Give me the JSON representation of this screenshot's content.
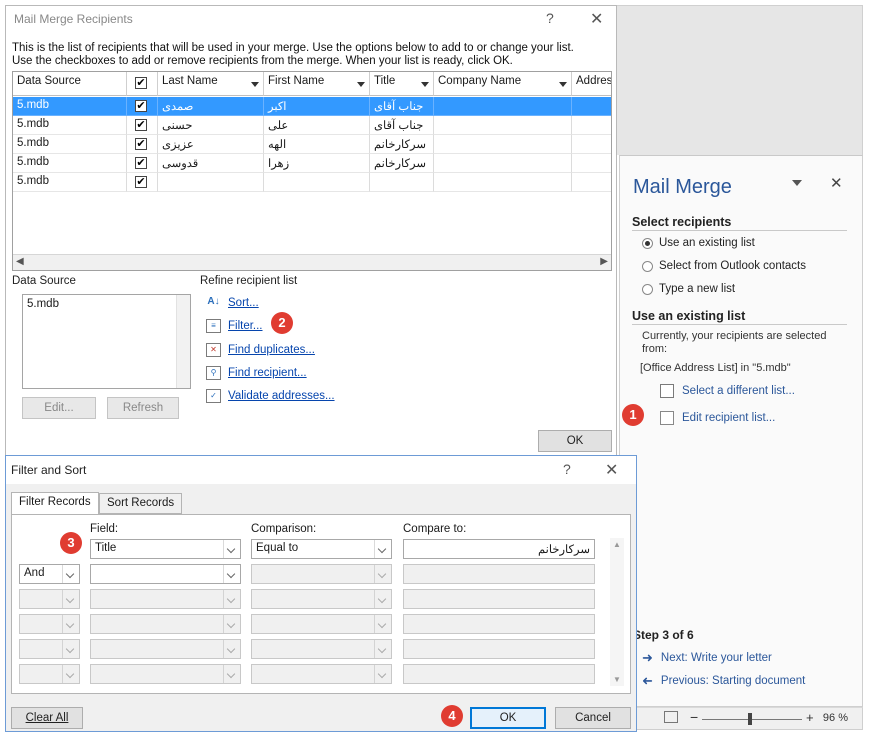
{
  "mail_merge_recipients": {
    "title": "Mail Merge Recipients",
    "help": "?",
    "close": "✕",
    "info_line1": "This is the list of recipients that will be used in your merge.  Use the options below to add to or change your list.",
    "info_line2": "Use the checkboxes to add or remove recipients from the merge.  When your list is ready, click OK.",
    "columns": [
      "Data Source",
      "",
      "Last Name",
      "First Name",
      "Title",
      "Company Name",
      "Address"
    ],
    "rows": [
      {
        "source": "5.mdb",
        "checked": "✔",
        "last": "صمدی",
        "first": "اکبر",
        "title": "جناب آقای"
      },
      {
        "source": "5.mdb",
        "checked": "✔",
        "last": "حسنی",
        "first": "علی",
        "title": "جناب آقای"
      },
      {
        "source": "5.mdb",
        "checked": "✔",
        "last": "عزیزی",
        "first": "الهه",
        "title": "سرکارخانم"
      },
      {
        "source": "5.mdb",
        "checked": "✔",
        "last": "قدوسی",
        "first": "زهرا",
        "title": "سرکارخانم"
      },
      {
        "source": "5.mdb",
        "checked": "✔",
        "last": "",
        "first": "",
        "title": ""
      }
    ],
    "header_check": "✔",
    "data_source_label": "Data Source",
    "data_source_item": "5.mdb",
    "edit_button": "Edit...",
    "refresh_button": "Refresh",
    "refine_label": "Refine recipient list",
    "links": {
      "sort": "Sort...",
      "filter": "Filter...",
      "find_duplicates": "Find duplicates...",
      "find_recipient": "Find recipient...",
      "validate": "Validate addresses..."
    },
    "ok_button": "OK"
  },
  "filter_sort": {
    "title": "Filter and Sort",
    "help": "?",
    "close": "✕",
    "tabs": [
      "Filter Records",
      "Sort Records"
    ],
    "headers": {
      "field": "Field:",
      "comparison": "Comparison:",
      "compare_to": "Compare to:"
    },
    "row1": {
      "field": "Title",
      "comparison": "Equal to",
      "compare_to": "سرکارخانم"
    },
    "row2": {
      "conj": "And"
    },
    "clear_all": "Clear All",
    "ok": "OK",
    "cancel": "Cancel"
  },
  "task_pane": {
    "title": "Mail Merge",
    "close": "✕",
    "select_recipients": "Select recipients",
    "options": [
      "Use an existing list",
      "Select from Outlook contacts",
      "Type a new list"
    ],
    "use_existing_heading": "Use an existing list",
    "desc": "Currently, your recipients are selected from:",
    "source_text": "[Office Address List] in \"5.mdb\"",
    "select_different": "Select a different list...",
    "edit_list": "Edit recipient list...",
    "step": "Step 3 of 6",
    "next": "Next: Write your letter",
    "previous": "Previous: Starting document"
  },
  "status_bar": {
    "minus": "−",
    "plus": "+",
    "zoom": "96 %"
  },
  "badges": [
    "1",
    "2",
    "3",
    "4"
  ],
  "colors": {
    "accent": "#2b579a",
    "selection": "#3399ff",
    "badge": "#e03c31",
    "link": "#0645ad"
  }
}
